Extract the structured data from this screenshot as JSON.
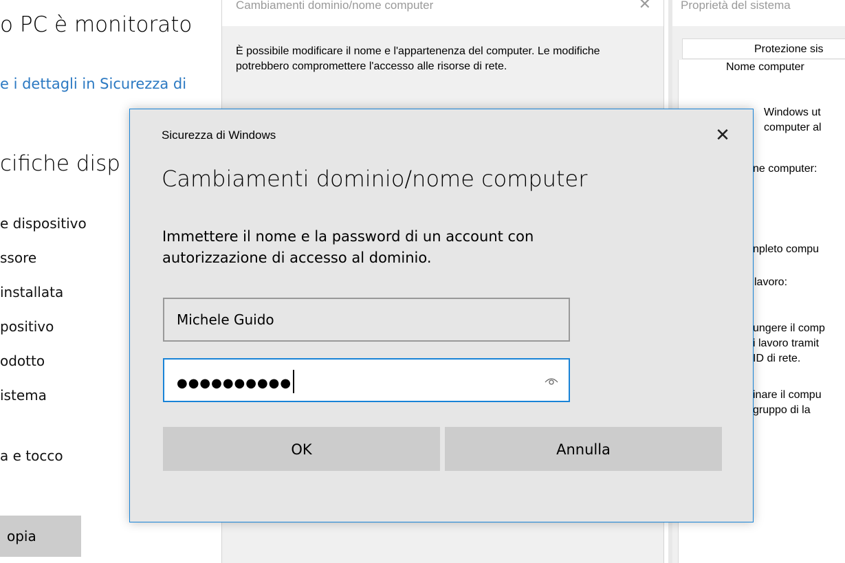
{
  "settings": {
    "title": "o PC è monitorato",
    "link": "e i dettagli in Sicurezza di",
    "heading": "cifiche disp",
    "items": [
      "e dispositivo",
      "ssore",
      "installata",
      "positivo",
      "odotto",
      "istema",
      "a e tocco"
    ],
    "copy_button": "opia"
  },
  "bg_dialog": {
    "title": "Cambiamenti dominio/nome computer",
    "close": "✕",
    "description": "È possibile modificare il nome e l'appartenenza del computer. Le modifiche potrebbero compromettere l'accesso alle risorse di rete."
  },
  "system_properties": {
    "title": "Proprietà del sistema",
    "tab": "Protezione sis",
    "computer_name_label": "Nome computer",
    "lines": [
      "Windows ut",
      "computer al",
      "ne computer:",
      "npleto compu",
      "lavoro:",
      "ungere il comp",
      "i lavoro tramit",
      "ID di rete.",
      "inare il compu",
      "gruppo di la"
    ]
  },
  "security_dialog": {
    "app_name": "Sicurezza di Windows",
    "close": "✕",
    "title": "Cambiamenti dominio/nome computer",
    "description": "Immettere il nome e la password di un account con autorizzazione di accesso al dominio.",
    "username_value": "Michele Guido",
    "password_mask": "●●●●●●●●●●",
    "ok_label": "OK",
    "cancel_label": "Annulla",
    "accent_color": "#1883d7"
  },
  "icons": {
    "close": "close-icon",
    "eye": "eye-icon"
  }
}
